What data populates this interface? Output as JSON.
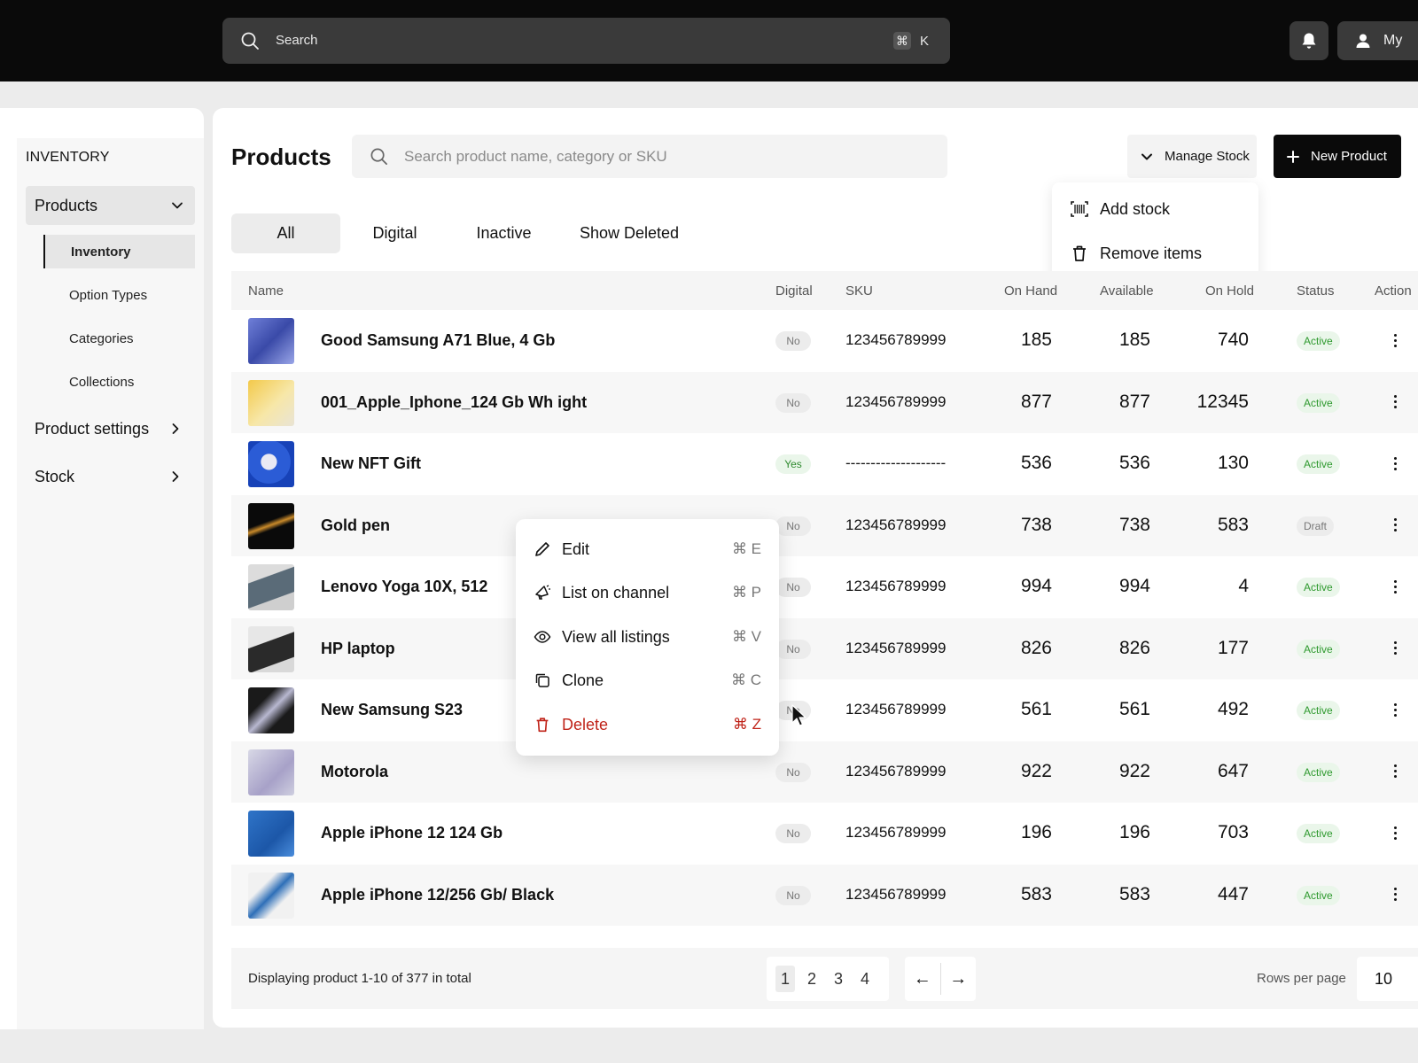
{
  "topbar": {
    "search_placeholder": "Search",
    "shortcut_key": "K",
    "shortcut_cmd": "⌘",
    "user_label": "My"
  },
  "sidebar": {
    "heading": "INVENTORY",
    "products_label": "Products",
    "sub_items": [
      "Inventory",
      "Option Types",
      "Categories",
      "Collections"
    ],
    "product_settings_label": "Product settings",
    "stock_label": "Stock"
  },
  "header": {
    "title": "Products",
    "search_placeholder": "Search  product name, category or SKU",
    "manage_stock_label": "Manage Stock",
    "new_product_label": "New Product"
  },
  "stock_menu": {
    "add_stock": "Add stock",
    "remove_items": "Remove items"
  },
  "tabs": [
    "All",
    "Digital",
    "Inactive",
    "Show Deleted"
  ],
  "table": {
    "columns": [
      "Name",
      "Digital",
      "SKU",
      "On Hand",
      "Available",
      "On Hold",
      "Status",
      "Action"
    ],
    "rows": [
      {
        "name": "Good Samsung A71 Blue, 4 Gb",
        "digital": "No",
        "sku": "123456789999",
        "on_hand": "185",
        "available": "185",
        "on_hold": "740",
        "status": "Active"
      },
      {
        "name": "001_Apple_Iphone_124 Gb Wh ight",
        "digital": "No",
        "sku": "123456789999",
        "on_hand": "877",
        "available": "877",
        "on_hold": "12345",
        "status": "Active"
      },
      {
        "name": "New NFT Gift",
        "digital": "Yes",
        "sku": "--------------------",
        "on_hand": "536",
        "available": "536",
        "on_hold": "130",
        "status": "Active"
      },
      {
        "name": "Gold pen",
        "digital": "No",
        "sku": "123456789999",
        "on_hand": "738",
        "available": "738",
        "on_hold": "583",
        "status": "Draft"
      },
      {
        "name": "Lenovo Yoga 10X, 512",
        "digital": "No",
        "sku": "123456789999",
        "on_hand": "994",
        "available": "994",
        "on_hold": "4",
        "status": "Active"
      },
      {
        "name": "HP laptop",
        "digital": "No",
        "sku": "123456789999",
        "on_hand": "826",
        "available": "826",
        "on_hold": "177",
        "status": "Active"
      },
      {
        "name": "New Samsung S23",
        "digital": "No",
        "sku": "123456789999",
        "on_hand": "561",
        "available": "561",
        "on_hold": "492",
        "status": "Active"
      },
      {
        "name": "Motorola",
        "digital": "No",
        "sku": "123456789999",
        "on_hand": "922",
        "available": "922",
        "on_hold": "647",
        "status": "Active"
      },
      {
        "name": "Apple iPhone 12 124 Gb",
        "digital": "No",
        "sku": "123456789999",
        "on_hand": "196",
        "available": "196",
        "on_hold": "703",
        "status": "Active"
      },
      {
        "name": "Apple iPhone 12/256 Gb/ Black",
        "digital": "No",
        "sku": "123456789999",
        "on_hand": "583",
        "available": "583",
        "on_hold": "447",
        "status": "Active"
      }
    ]
  },
  "context_menu": {
    "items": [
      {
        "label": "Edit",
        "shortcut": "⌘ E"
      },
      {
        "label": "List on channel",
        "shortcut": "⌘ P"
      },
      {
        "label": "View all listings",
        "shortcut": "⌘ V"
      },
      {
        "label": "Clone",
        "shortcut": "⌘ C"
      },
      {
        "label": "Delete",
        "shortcut": "⌘ Z"
      }
    ]
  },
  "footer": {
    "display_text": "Displaying product 1-10 of 377 in total",
    "pages": [
      "1",
      "2",
      "3",
      "4"
    ],
    "prev_arrow": "←",
    "next_arrow": "→",
    "rows_per_page_label": "Rows per page",
    "rows_per_page_value": "10"
  },
  "colors": {
    "topbar": "#0a0a0a",
    "active_status": "#2f9a2f",
    "danger": "#c0241a"
  }
}
